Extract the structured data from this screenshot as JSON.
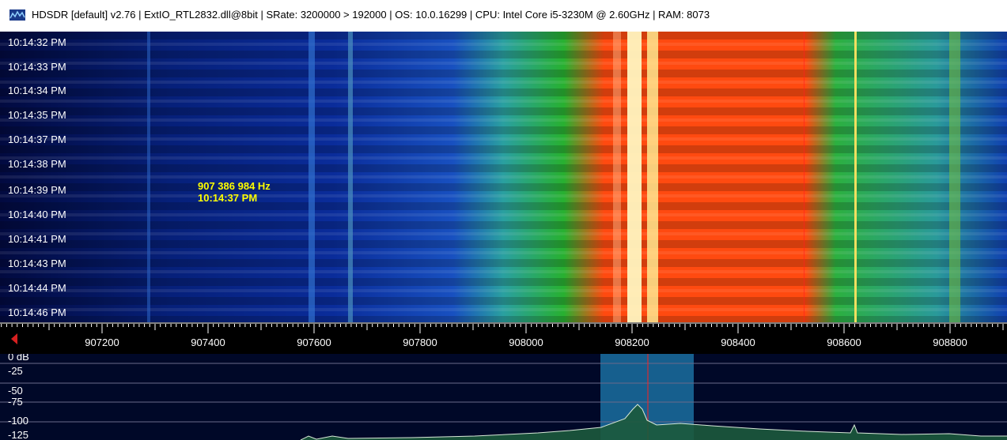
{
  "window": {
    "title": "HDSDR  [default]  v2.76   |  ExtIO_RTL2832.dll@8bit  |  SRate: 3200000 > 192000  |  OS: 10.0.16299   |  CPU: Intel Core i5-3230M @ 2.60GHz  |  RAM: 8073"
  },
  "waterfall": {
    "timestamps": [
      "10:14:32 PM",
      "10:14:33 PM",
      "10:14:34 PM",
      "10:14:35 PM",
      "10:14:37 PM",
      "10:14:38 PM",
      "10:14:39 PM",
      "10:14:40 PM",
      "10:14:41 PM",
      "10:14:43 PM",
      "10:14:44 PM",
      "10:14:46 PM"
    ],
    "cursor": {
      "frequency": "907 386 984 Hz",
      "time": "10:14:37 PM"
    }
  },
  "freq_axis": {
    "labels": [
      "907200",
      "907400",
      "907600",
      "907800",
      "908000",
      "908200",
      "908400",
      "908600",
      "908800"
    ]
  },
  "spectrum": {
    "db_labels": [
      "0 dB",
      "-25",
      "-50",
      "-75",
      "-100",
      "-125"
    ]
  },
  "colors": {
    "waterfall_bg": "#020a40",
    "signal_hot": "#ff4a10",
    "signal_peak": "#fff4c0",
    "signal_mid": "#30b030",
    "marker_yellow": "#f0e060",
    "filter_band": "#1a6ea0",
    "tune_marker": "#ff2020"
  }
}
